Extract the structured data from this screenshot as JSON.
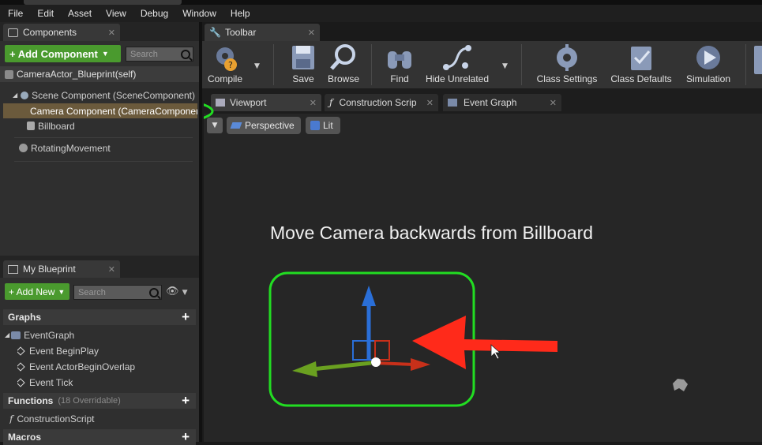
{
  "menu": [
    "File",
    "Edit",
    "Asset",
    "View",
    "Debug",
    "Window",
    "Help"
  ],
  "components_panel": {
    "tab_label": "Components",
    "add_button": "+ Add Component",
    "search_placeholder": "Search",
    "actor_label": "CameraActor_Blueprint(self)",
    "items": [
      {
        "label": "Scene Component (SceneComponent)",
        "icon": "scene-component-icon"
      },
      {
        "label": "Camera Component (CameraComponent)",
        "icon": "camera-icon",
        "selected": true
      },
      {
        "label": "Billboard",
        "icon": "billboard-icon"
      },
      {
        "label": "RotatingMovement",
        "icon": "rotating-movement-icon"
      }
    ]
  },
  "my_blueprint": {
    "tab_label": "My Blueprint",
    "add_button": "+ Add New",
    "search_placeholder": "Search",
    "graphs_header": "Graphs",
    "event_graph": "EventGraph",
    "events": [
      "Event BeginPlay",
      "Event ActorBeginOverlap",
      "Event Tick"
    ],
    "functions_header": "Functions",
    "functions_count": "(18 Overridable)",
    "construction_script": "ConstructionScript",
    "macros_header": "Macros"
  },
  "toolbar": {
    "tab_label": "Toolbar",
    "buttons": [
      "Compile",
      "Save",
      "Browse",
      "Find",
      "Hide Unrelated",
      "Class Settings",
      "Class Defaults",
      "Simulation"
    ]
  },
  "doc_tabs": [
    "Viewport",
    "Construction Scrip",
    "Event Graph"
  ],
  "viewport": {
    "perspective_label": "Perspective",
    "lit_label": "Lit",
    "instruction": "Move Camera backwards from Billboard"
  },
  "colors": {
    "accent_green": "#4a9a2e",
    "annotation_green": "#22dd22",
    "annotation_red": "#ff2a1a",
    "selection": "#6b5a3c"
  }
}
